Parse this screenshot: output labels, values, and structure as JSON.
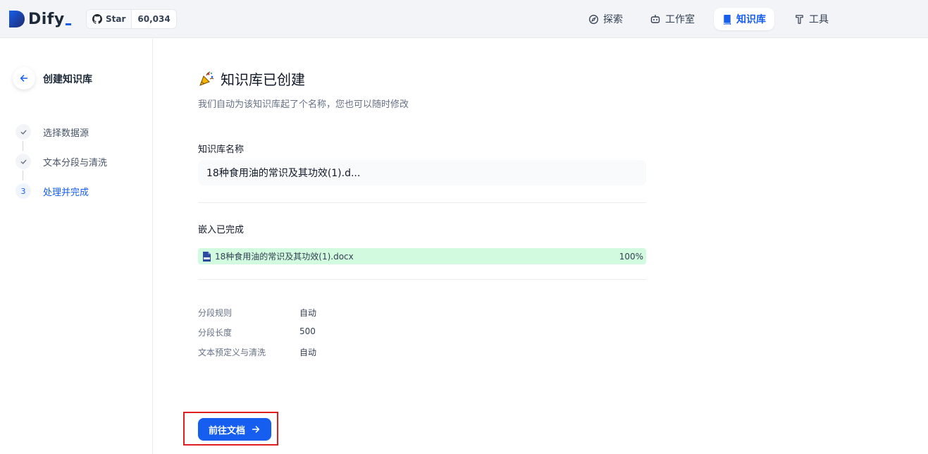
{
  "header": {
    "logo_text": "Dify",
    "github": {
      "star_label": "Star",
      "star_count": "60,034"
    },
    "nav": [
      {
        "label": "探索",
        "icon": "compass-icon",
        "active": false
      },
      {
        "label": "工作室",
        "icon": "robot-icon",
        "active": false
      },
      {
        "label": "知识库",
        "icon": "book-icon",
        "active": true
      },
      {
        "label": "工具",
        "icon": "hammer-icon",
        "active": false
      }
    ]
  },
  "sidebar": {
    "title": "创建知识库",
    "steps": [
      {
        "label": "选择数据源",
        "state": "done"
      },
      {
        "label": "文本分段与清洗",
        "state": "done"
      },
      {
        "number": "3",
        "label": "处理并完成",
        "state": "current"
      }
    ]
  },
  "main": {
    "title": "知识库已创建",
    "subtitle": "我们自动为该知识库起了个名称，您也可以随时修改",
    "name_label": "知识库名称",
    "name_value": "18种食用油的常识及其功效(1).d...",
    "embed_label": "嵌入已完成",
    "file": {
      "name": "18种食用油的常识及其功效(1).docx",
      "progress": "100%"
    },
    "settings": [
      {
        "key": "分段规则",
        "value": "自动"
      },
      {
        "key": "分段长度",
        "value": "500"
      },
      {
        "key": "文本预定义与清洗",
        "value": "自动"
      }
    ],
    "goto_button": "前往文档"
  },
  "colors": {
    "accent": "#155eef",
    "progress_bg": "#d1fadf",
    "highlight_border": "#e02020"
  }
}
